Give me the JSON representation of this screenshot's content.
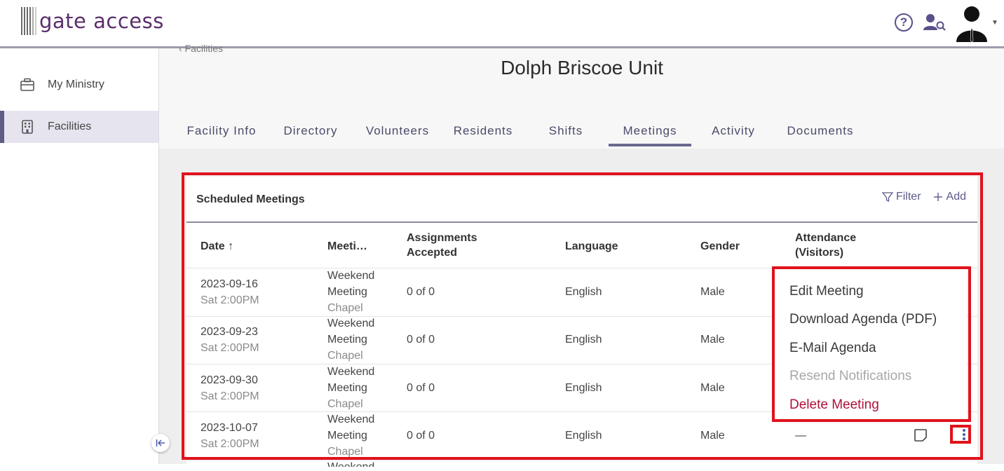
{
  "app": {
    "logo_text": "gate access"
  },
  "sidebar": {
    "items": [
      {
        "label": "My Ministry",
        "icon": "briefcase-icon"
      },
      {
        "label": "Facilities",
        "icon": "building-icon"
      }
    ]
  },
  "header": {
    "back_link": "‹ Facilities",
    "title": "Dolph Briscoe Unit",
    "tabs": [
      {
        "label": "Facility Info"
      },
      {
        "label": "Directory"
      },
      {
        "label": "Volunteers"
      },
      {
        "label": "Residents"
      },
      {
        "label": "Shifts"
      },
      {
        "label": "Meetings",
        "active": true
      },
      {
        "label": "Activity"
      },
      {
        "label": "Documents"
      }
    ]
  },
  "card": {
    "title": "Scheduled Meetings",
    "filter_label": "Filter",
    "add_label": "Add",
    "columns": {
      "date": "Date ↑",
      "meeting": "Meeti…",
      "assignments_1": "Assignments",
      "assignments_2": "Accepted",
      "language": "Language",
      "gender": "Gender",
      "attendance_1": "Attendance",
      "attendance_2": "(Visitors)"
    },
    "rows": [
      {
        "date": "2023-09-16",
        "time": "Sat 2:00PM",
        "meeting_1": "Weekend",
        "meeting_2": "Meeting",
        "location": "Chapel",
        "assignments": "0 of 0",
        "language": "English",
        "gender": "Male",
        "attendance": ""
      },
      {
        "date": "2023-09-23",
        "time": "Sat 2:00PM",
        "meeting_1": "Weekend",
        "meeting_2": "Meeting",
        "location": "Chapel",
        "assignments": "0 of 0",
        "language": "English",
        "gender": "Male",
        "attendance": ""
      },
      {
        "date": "2023-09-30",
        "time": "Sat 2:00PM",
        "meeting_1": "Weekend",
        "meeting_2": "Meeting",
        "location": "Chapel",
        "assignments": "0 of 0",
        "language": "English",
        "gender": "Male",
        "attendance": ""
      },
      {
        "date": "2023-10-07",
        "time": "Sat 2:00PM",
        "meeting_1": "Weekend",
        "meeting_2": "Meeting",
        "location": "Chapel",
        "assignments": "0 of 0",
        "language": "English",
        "gender": "Male",
        "attendance": "—"
      }
    ],
    "partial_next_row": "Weekend"
  },
  "menu": {
    "items": [
      {
        "label": "Edit Meeting",
        "state": "normal"
      },
      {
        "label": "Download Agenda (PDF)",
        "state": "normal"
      },
      {
        "label": "E-Mail Agenda",
        "state": "normal"
      },
      {
        "label": "Resend Notifications",
        "state": "disabled"
      },
      {
        "label": "Delete Meeting",
        "state": "danger"
      }
    ]
  },
  "colors": {
    "highlight": "#e0121c",
    "accent": "#5f5d86",
    "danger": "#b0103a"
  }
}
